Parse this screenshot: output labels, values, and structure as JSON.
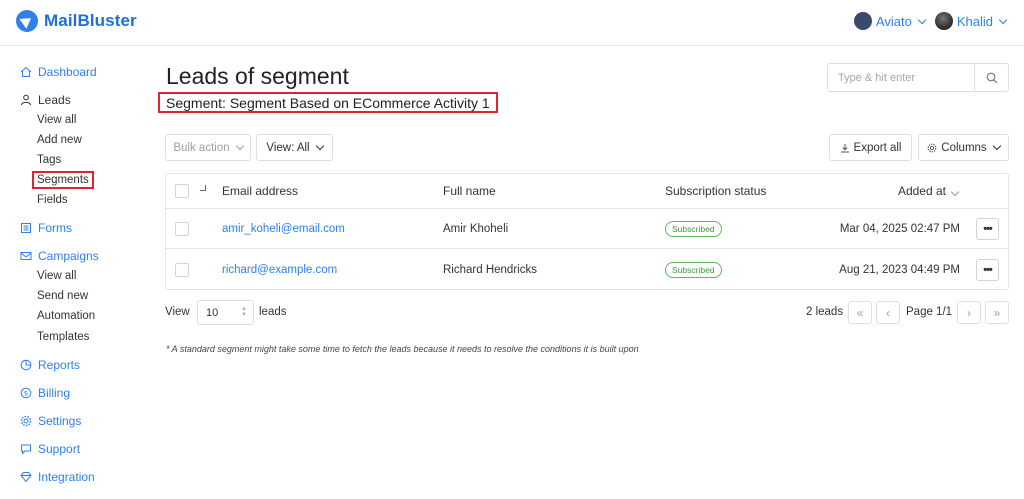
{
  "app": {
    "name": "MailBluster"
  },
  "header": {
    "workspace": "Aviato",
    "user": "Khalid"
  },
  "sidebar": {
    "dashboard": "Dashboard",
    "leads": "Leads",
    "leads_sub": [
      "View all",
      "Add new",
      "Tags",
      "Segments",
      "Fields"
    ],
    "forms": "Forms",
    "campaigns": "Campaigns",
    "campaigns_sub": [
      "View all",
      "Send new",
      "Automation",
      "Templates"
    ],
    "reports": "Reports",
    "billing": "Billing",
    "settings": "Settings",
    "support": "Support",
    "integration": "Integration"
  },
  "main": {
    "title": "Leads of segment",
    "segment_label": "Segment: Segment Based on ECommerce Activity 1",
    "search_placeholder": "Type & hit enter",
    "bulk_action": "Bulk action",
    "view_filter": "View: All",
    "export_all": "Export all",
    "columns": "Columns"
  },
  "table": {
    "headers": {
      "email": "Email address",
      "name": "Full name",
      "status": "Subscription status",
      "added": "Added at"
    },
    "rows": [
      {
        "email": "amir_koheli@email.com",
        "name": "Amir Khoheli",
        "status": "Subscribed",
        "added": "Mar 04, 2025 02:47 PM"
      },
      {
        "email": "richard@example.com",
        "name": "Richard Hendricks",
        "status": "Subscribed",
        "added": "Aug 21, 2023 04:49 PM"
      }
    ]
  },
  "pagination": {
    "view_label": "View",
    "per_page": "10",
    "leads_label": "leads",
    "count": "2 leads",
    "page": "Page 1/1"
  },
  "note": "* A standard segment might take some time to fetch the leads because it needs to resolve the conditions it is built upon",
  "colors": {
    "accent": "#2f80ed",
    "highlight": "#e0242f",
    "subscribed": "#5cb85c"
  }
}
